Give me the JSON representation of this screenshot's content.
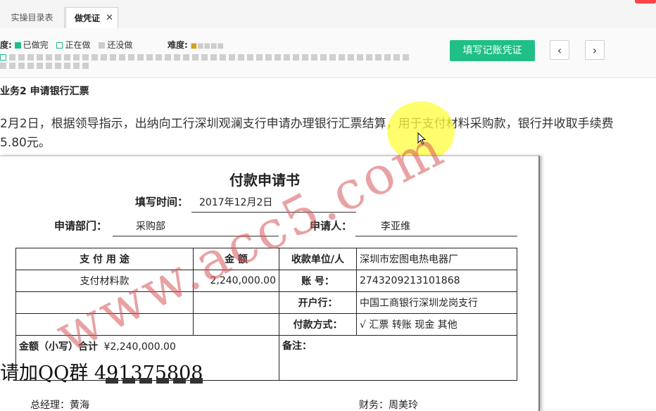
{
  "tabs": [
    {
      "label": "实操目录表"
    },
    {
      "label": "做凭证",
      "close": "✕"
    }
  ],
  "toolbar": {
    "progress_label": "度:",
    "legend_done": "已做完",
    "legend_doing": "正在做",
    "legend_todo": "还没做",
    "difficulty_label": "难度:",
    "fill_button": "填写记账凭证",
    "prev": "‹",
    "next": "›",
    "colors": {
      "done": "#1fbf86",
      "doing": "#1fbf86",
      "todo": "#cccccc"
    }
  },
  "task": {
    "title": "业务2 申请银行汇票",
    "desc_line1": "2月2日，根据领导指示，出纳向工行深圳观澜支行申请办理银行汇票结算，用于支付材料采购款，银行并收取手续费",
    "desc_line2": "5.80元。"
  },
  "form": {
    "title": "付款申请书",
    "fill_time_label": "填写时间：",
    "fill_time": "2017年12月2日",
    "dept_label": "申请部门：",
    "dept": "采购部",
    "applicant_label": "申请人：",
    "applicant": "李亚维",
    "col_purpose": "支 付 用 途",
    "col_amount": "金    额",
    "col_payee": "收款单位/人",
    "payee": "深圳市宏图电热电器厂",
    "purpose": "支付材料款",
    "amount": "2,240,000.00",
    "account_label": "账    号：",
    "account": "2743209213101868",
    "bank_label": "开户行：",
    "bank": "中国工商银行深圳龙岗支行",
    "pay_method_label": "付款方式：",
    "pay_method": "√  汇票      转账     现金     其他",
    "total_label": "金额（小写）合计",
    "total": "¥2,240,000.00",
    "remark_label": "备注：",
    "gm": "总经理：黄海",
    "finance": "财务：周美玲"
  },
  "watermark": "www.acc5.com",
  "overlay_text": "请加QQ群 491375808"
}
